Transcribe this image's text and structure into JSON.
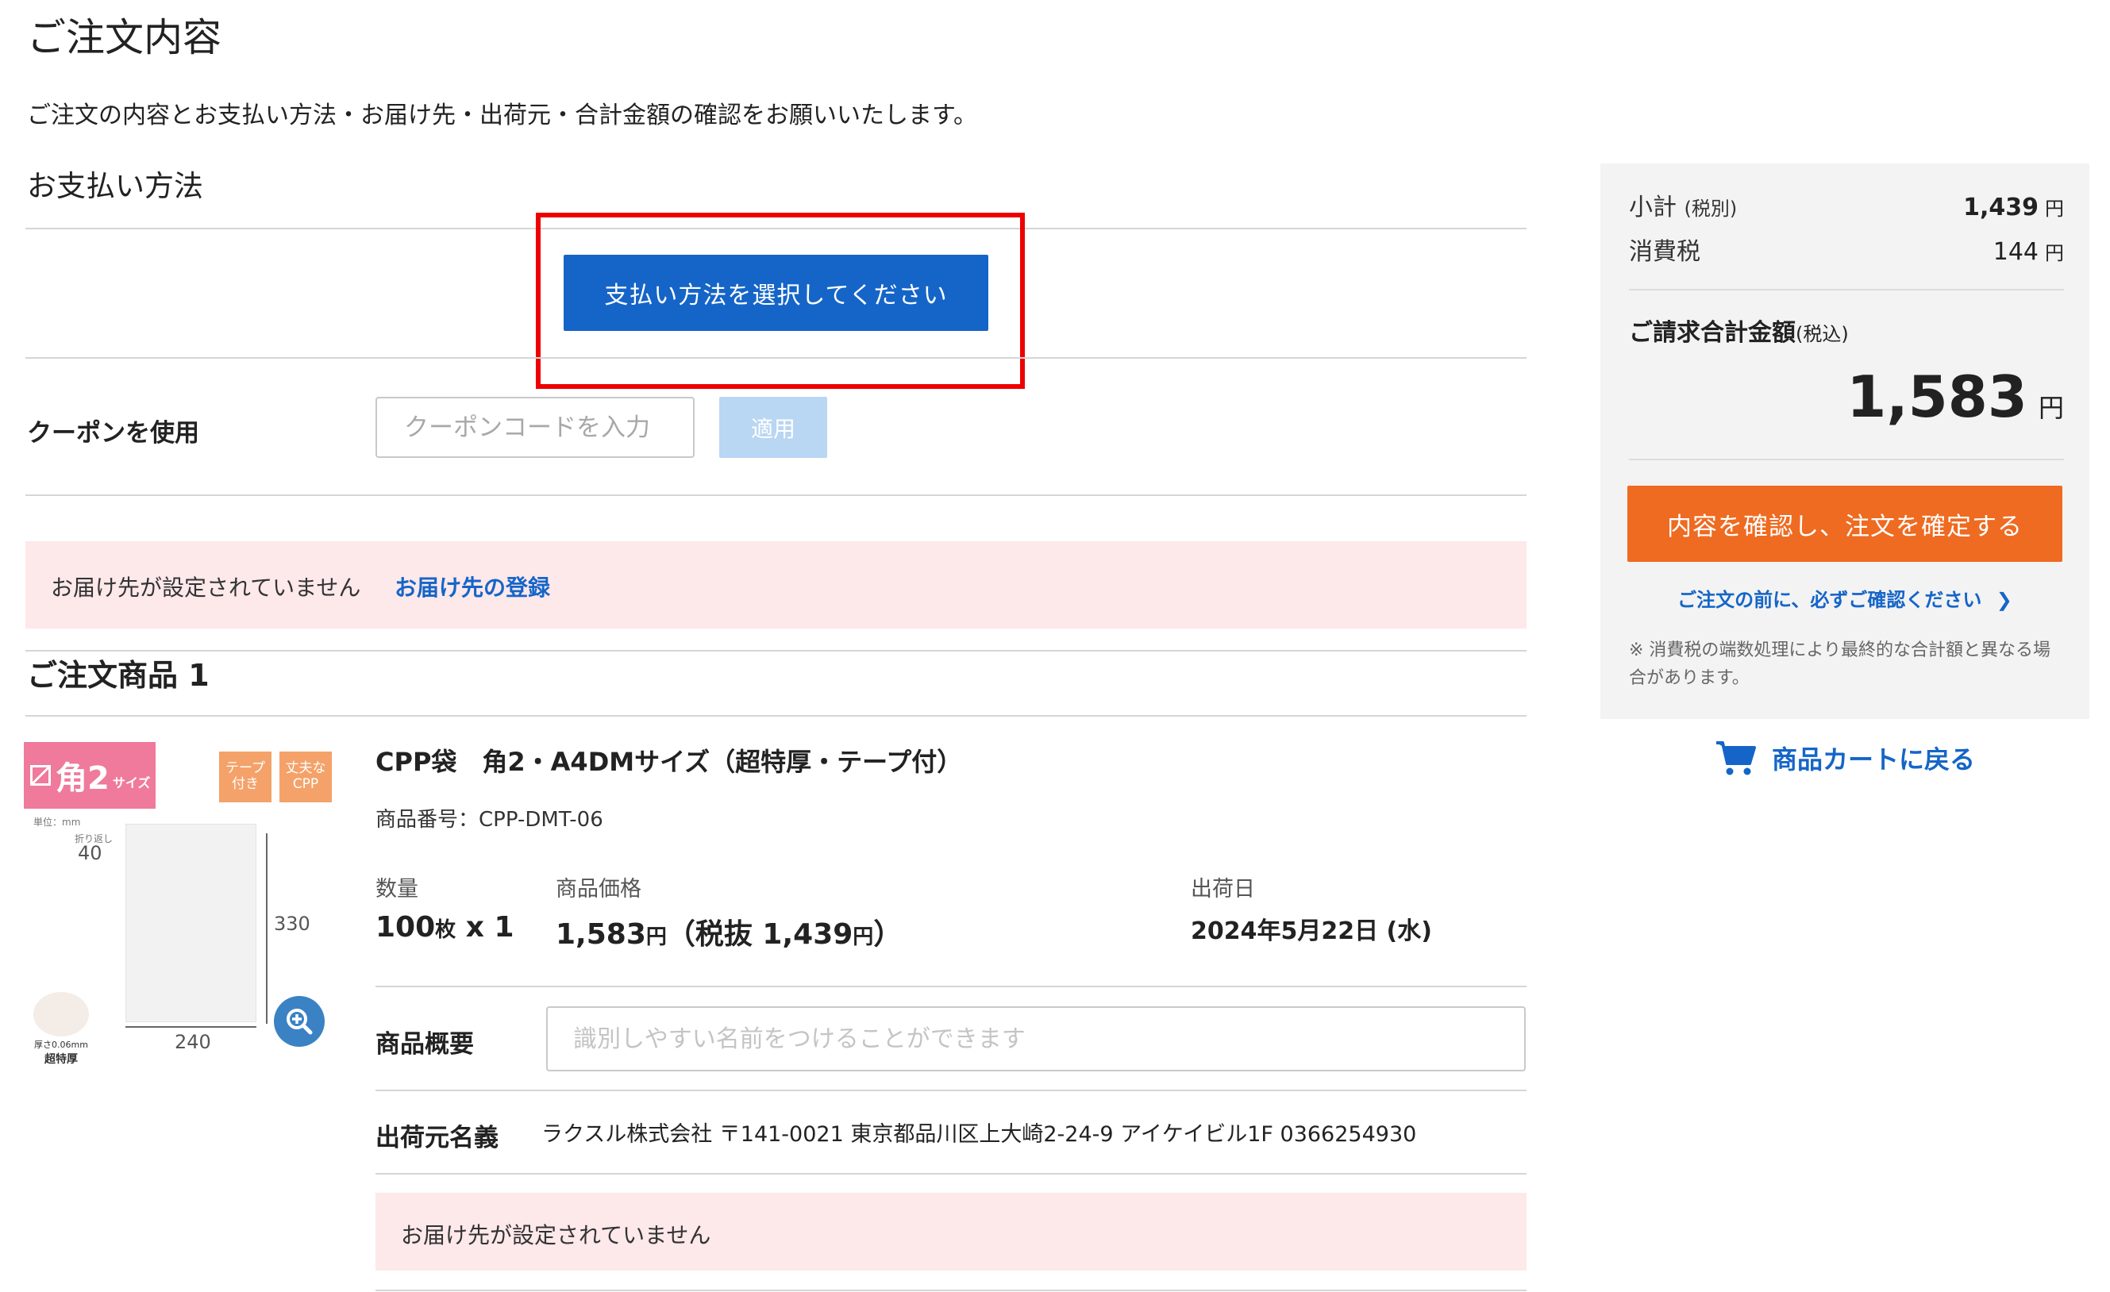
{
  "header": {
    "title": "ご注文内容",
    "description": "ご注文の内容とお支払い方法・お届け先・出荷元・合計金額の確認をお願いいたします。"
  },
  "payment": {
    "section_title": "お支払い方法",
    "select_button": "支払い方法を選択してください"
  },
  "coupon": {
    "label": "クーポンを使用",
    "placeholder": "クーポンコードを入力",
    "apply_button": "適用"
  },
  "delivery_alert": {
    "message": "お届け先が設定されていません",
    "register_link": "お届け先の登録"
  },
  "order_items": {
    "section_title": "ご注文商品 1",
    "item": {
      "badge_size": "角2",
      "badge_size_suffix": "サイズ",
      "tag_tape": "テープ付き",
      "tag_strong": "丈夫なCPP",
      "unit_note": "単位：mm",
      "fold_note": "折り返し",
      "dim_flap": "40",
      "dim_height": "330",
      "dim_width": "240",
      "thickness_note": "厚さ0.06mm",
      "thickness_label": "超特厚",
      "name": "CPP袋　角2・A4DMサイズ（超特厚・テープ付）",
      "product_number": "商品番号：CPP-DMT-06",
      "quantity_label": "数量",
      "quantity_value": "100",
      "quantity_unit": "枚",
      "quantity_times": "x 1",
      "price_label": "商品価格",
      "price_value": "1,583",
      "price_yen": "円",
      "price_excl_prefix": "（税抜 1,439",
      "price_excl_suffix": "）",
      "ship_date_label": "出荷日",
      "ship_date_value": "2024年5月22日 (水)",
      "summary_label": "商品概要",
      "summary_placeholder": "識別しやすい名前をつけることができます",
      "shipper_label": "出荷元名義",
      "shipper_value": "ラクスル株式会社 〒141-0021 東京都品川区上大崎2-24-9 アイケイビル1F 0366254930",
      "delivery_message": "お届け先が設定されていません"
    }
  },
  "sidebar": {
    "subtotal_label": "小計",
    "subtotal_note": "(税別)",
    "subtotal_value": "1,439",
    "tax_label": "消費税",
    "tax_value": "144",
    "yen": "円",
    "total_label": "ご請求合計金額",
    "total_note": "(税込)",
    "total_value": "1,583",
    "confirm_button": "内容を確認し、注文を確定する",
    "check_link": "ご注文の前に、必ずご確認ください",
    "note": "※ 消費税の端数処理により最終的な合計額と異なる場合があります。"
  },
  "cart": {
    "back_link": "商品カートに戻る"
  },
  "colors": {
    "primary": "#1565c8",
    "accent_orange": "#ee6b21",
    "highlight_red": "#ee0000",
    "alert_bg": "#fde8ea"
  }
}
